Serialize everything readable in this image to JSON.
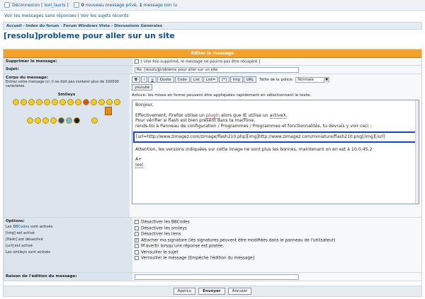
{
  "top": {
    "logout": "Déconnexion [ lool_lauris ]",
    "pm_count": "0",
    "pm_text": "nouveau message privé,",
    "unread_count": "1",
    "unread_text": "message non lu"
  },
  "links": {
    "unanswered": "Voir les messages sans réponses",
    "sep": "|",
    "recent": "Voir les sujets récents"
  },
  "breadcrumb": [
    "Accueil",
    "Index du forum",
    "Forum Windows Vista",
    "Discussions Générales"
  ],
  "page_title": "[resolu]probleme pour aller sur un site",
  "form": {
    "header": "Editer le message",
    "delete_label": "Supprimer le message:",
    "delete_note": "[ Une fois supprimé, le message ne pourra pas être récupéré ]",
    "subject_label": "Sujet:",
    "subject_value": "Re: [resolu]probleme pour aller sur un site",
    "body_label": "Corps du message:",
    "body_note": "Entrez votre message ici. Il ne doit pas contenir plus de 100000 caractères.",
    "smileys_label": "Smileys",
    "toolbar": [
      "B",
      "i",
      "u",
      "Quote",
      "Code",
      "List",
      "List=",
      "[*]",
      "Img",
      "URL"
    ],
    "size_label": "Taille de la police:",
    "size_value": "Normale",
    "youtube": "youtube",
    "tip": "Astuce: les mises en forme peuvent être appliquées rapidement en sélectionnant le texte.",
    "body": {
      "l1": "Bonjour,",
      "l2a": "Effectivement, Firefox utilise un ",
      "l2b": "plugin",
      "l2c": " alors que ",
      "l2d": "IE",
      "l2e": " utilise un ",
      "l2f": "activeX",
      "l2g": ".",
      "l3": "Pour vérifier si flash est bien présent dans ta machine,",
      "l4": "rends-toi à Panneau de configuration / Programmes / Programmes et fonctionnalités, tu devrais y voir ceci :",
      "url": "[url=http://www.zimagez.com/zimage/flash210.php][img]http://www.zimagez.com/miniature/flash210.png[/img][/url]",
      "l5": "Attention, les versions indiquées sur cette image ne sont plus les bonnes, maintenant on en est à 10.0.45.2",
      "l6": "A+",
      "l7": "lool"
    },
    "options_label": "Options:",
    "options_info": [
      {
        "a": "Les ",
        "link": "BBCodes",
        "b": " sont activés"
      },
      {
        "a": "[img] est activé",
        "link": "",
        "b": ""
      },
      {
        "a": "[flash] est désactivé",
        "link": "",
        "b": ""
      },
      {
        "a": "[url] est activé",
        "link": "",
        "b": ""
      },
      {
        "a": "Les smileys sont activés",
        "link": "",
        "b": ""
      }
    ],
    "options": [
      {
        "label": "Désactiver les BBCodes",
        "checked": false
      },
      {
        "label": "Désactiver les smileys",
        "checked": false
      },
      {
        "label": "Désactiver les liens",
        "checked": false
      },
      {
        "label": "Attacher ma signature (les signatures peuvent être modifiées dans le panneau de l'utilisateur)",
        "checked": true
      },
      {
        "label": "M'avertir lorsqu'une réponse est postée.",
        "checked": false
      },
      {
        "label": "Verrouiller le sujet",
        "checked": false
      },
      {
        "label": "Verrouiller le message [Empêche l'édition du message]",
        "checked": false
      }
    ],
    "reason_label": "Raison de l'édition du message:",
    "buttons": {
      "preview": "Aperçu",
      "submit": "Envoyer",
      "cancel": "Annuler"
    }
  }
}
